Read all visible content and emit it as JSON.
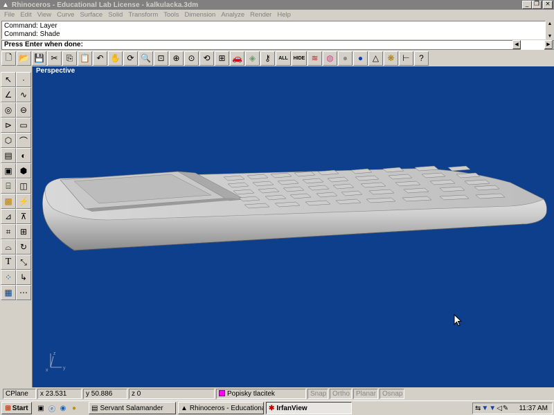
{
  "window": {
    "title": "Rhinoceros - Educational Lab License - kalkulacka.3dm",
    "minimize": "_",
    "restore": "❐",
    "close": "×"
  },
  "menu": [
    "File",
    "Edit",
    "View",
    "Curve",
    "Surface",
    "Solid",
    "Transform",
    "Tools",
    "Dimension",
    "Analyze",
    "Render",
    "Help"
  ],
  "command_history": [
    "Command: Layer",
    "Command: Shade"
  ],
  "prompt": "Press Enter when done:",
  "toolbar": {
    "buttons": [
      {
        "icon": "new-document-icon",
        "glyph": "🗋"
      },
      {
        "icon": "open-folder-icon",
        "glyph": "📂"
      },
      {
        "icon": "save-icon",
        "glyph": "💾"
      },
      {
        "icon": "cut-icon",
        "glyph": "✂"
      },
      {
        "icon": "copy-icon",
        "glyph": "⎘"
      },
      {
        "icon": "paste-icon",
        "glyph": "📋"
      },
      {
        "icon": "undo-icon",
        "glyph": "↶"
      },
      {
        "icon": "pan-hand-icon",
        "glyph": "✋"
      },
      {
        "icon": "rotate-view-icon",
        "glyph": "⟳"
      },
      {
        "icon": "zoom-dynamic-icon",
        "glyph": "🔍"
      },
      {
        "icon": "zoom-window-icon",
        "glyph": "⊡"
      },
      {
        "icon": "zoom-extents-icon",
        "glyph": "⊕"
      },
      {
        "icon": "zoom-selected-icon",
        "glyph": "⊙"
      },
      {
        "icon": "undo-view-icon",
        "glyph": "⟲"
      },
      {
        "icon": "four-viewports-icon",
        "glyph": "⊞"
      },
      {
        "icon": "car-icon",
        "glyph": "🚗"
      },
      {
        "icon": "render-preview-icon",
        "glyph": "◈"
      },
      {
        "icon": "key-icon",
        "glyph": "⚷"
      }
    ],
    "show_all_label": "ALL",
    "hide_label": "HIDE",
    "buttons2": [
      {
        "icon": "layer-icon",
        "glyph": "≋"
      },
      {
        "icon": "color-wheel-icon",
        "glyph": "◍"
      },
      {
        "icon": "sphere-gray-icon",
        "glyph": "●"
      },
      {
        "icon": "sphere-blue-icon",
        "glyph": "●"
      },
      {
        "icon": "light-icon",
        "glyph": "△"
      },
      {
        "icon": "snap-icon",
        "glyph": "❋"
      },
      {
        "icon": "dimension-icon",
        "glyph": "⊢"
      },
      {
        "icon": "help-icon",
        "glyph": "?"
      }
    ]
  },
  "left_tools": [
    {
      "l": {
        "icon": "select-arrow-icon",
        "glyph": "↖"
      },
      "r": {
        "icon": "point-icon",
        "glyph": "·"
      }
    },
    {
      "l": {
        "icon": "polyline-icon",
        "glyph": "∠"
      },
      "r": {
        "icon": "curve-icon",
        "glyph": "∿"
      }
    },
    {
      "l": {
        "icon": "circle-icon",
        "glyph": "◎"
      },
      "r": {
        "icon": "ellipse-icon",
        "glyph": "⊖"
      }
    },
    {
      "l": {
        "icon": "arc-icon",
        "glyph": "⊳"
      },
      "r": {
        "icon": "rectangle-icon",
        "glyph": "▭"
      }
    },
    {
      "l": {
        "icon": "polygon-icon",
        "glyph": "⬡"
      },
      "r": {
        "icon": "fillet-icon",
        "glyph": "⌒"
      }
    },
    {
      "l": {
        "icon": "surface-icon",
        "glyph": "▤"
      },
      "r": {
        "icon": "surface-edit-icon",
        "glyph": "◐"
      }
    },
    {
      "l": {
        "icon": "box-icon",
        "glyph": "▣"
      },
      "r": {
        "icon": "boolean-icon",
        "glyph": "⬢"
      }
    },
    {
      "l": {
        "icon": "cylinder-icon",
        "glyph": "⌸"
      },
      "r": {
        "icon": "mesh-icon",
        "glyph": "◫"
      }
    },
    {
      "l": {
        "icon": "explode-icon",
        "glyph": "▩"
      },
      "r": {
        "icon": "lightning-icon",
        "glyph": "⚡"
      }
    },
    {
      "l": {
        "icon": "move-icon",
        "glyph": "⊿"
      },
      "r": {
        "icon": "copy-transform-icon",
        "glyph": "⊼"
      }
    },
    {
      "l": {
        "icon": "array-icon",
        "glyph": "⌗"
      },
      "r": {
        "icon": "group-icon",
        "glyph": "⊞"
      }
    },
    {
      "l": {
        "icon": "dimension-tool-icon",
        "glyph": "⌓"
      },
      "r": {
        "icon": "rotate-tool-icon",
        "glyph": "↻"
      }
    },
    {
      "l": {
        "icon": "text-icon",
        "glyph": "T"
      },
      "r": {
        "icon": "scale-icon",
        "glyph": "⤡"
      }
    },
    {
      "l": {
        "icon": "analyze-icon",
        "glyph": "⁘"
      },
      "r": {
        "icon": "curve-analyze-icon",
        "glyph": "↳"
      }
    },
    {
      "l": {
        "icon": "render-tool-icon",
        "glyph": "▦"
      },
      "r": {
        "icon": "points-on-icon",
        "glyph": "⋯"
      }
    }
  ],
  "viewport": {
    "label": "Perspective",
    "background": "#0d3f8c"
  },
  "status": {
    "cplane": "CPlane",
    "x": "x 23.531",
    "y": "y 50.886",
    "z": "z 0",
    "layer": "Popisky tlacitek",
    "layer_color": "#ff00ff",
    "snap": "Snap",
    "ortho": "Ortho",
    "planar": "Planar",
    "osnap": "Osnap"
  },
  "taskbar": {
    "start": "Start",
    "tasks": [
      {
        "label": "Servant Salamander",
        "active": false
      },
      {
        "label": "Rhinoceros - Educational ...",
        "active": false
      },
      {
        "label": "IrfanView",
        "active": true
      }
    ],
    "clock": "11:37 AM"
  }
}
